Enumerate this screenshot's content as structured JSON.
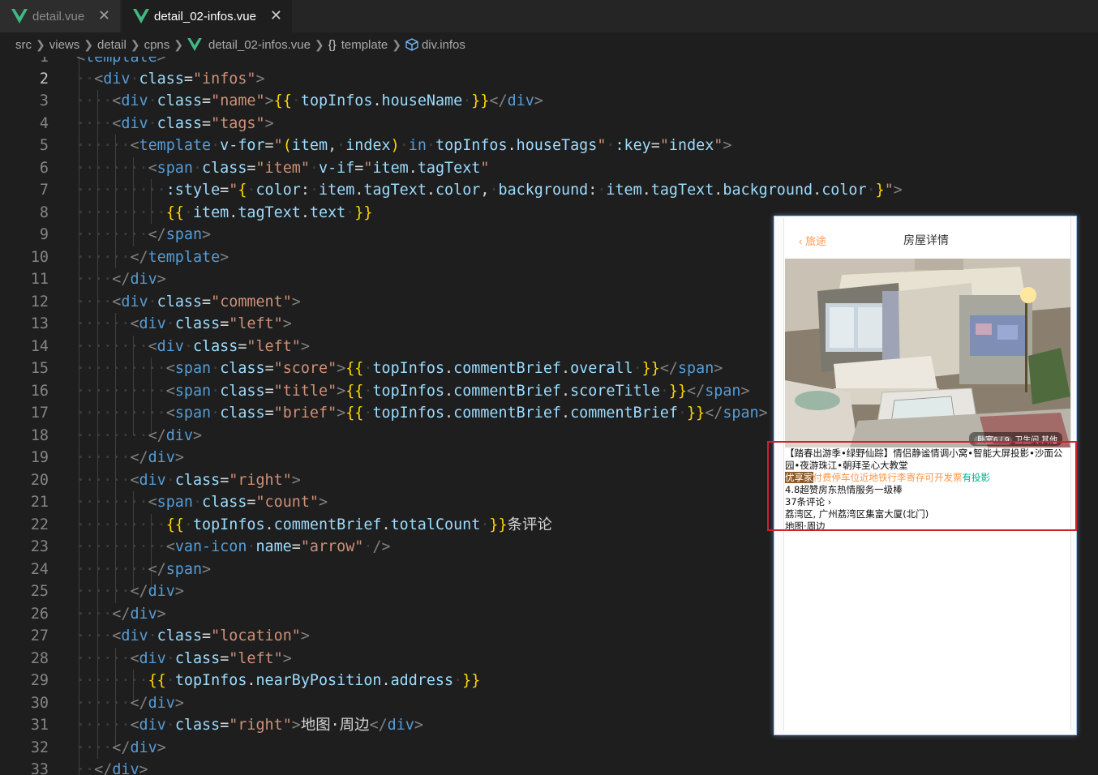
{
  "tabs": [
    {
      "label": "detail.vue"
    },
    {
      "label": "detail_02-infos.vue"
    }
  ],
  "breadcrumb": [
    "src",
    "views",
    "detail",
    "cpns",
    "detail_02-infos.vue",
    "template",
    "div.infos"
  ],
  "editor": {
    "current_line": 2
  },
  "preview": {
    "back_label": "旅途",
    "title": "房屋详情",
    "photo_indicator": {
      "active": "卧室6 / 9",
      "rest": "卫生间  其他"
    },
    "house_name": "【踏春出游季•绿野仙踪】情侣静谧情调小窝•智能大屏投影•沙面公园•夜游珠江•朝拜圣心大教堂",
    "tags": [
      {
        "text": "优享家",
        "color": "#ffffff",
        "background": "#8b5a2b"
      },
      {
        "text": "付费停车位近地铁行李寄存可开发票",
        "color": "#ff9645",
        "background": ""
      },
      {
        "text": "有投影",
        "color": "#00b38a",
        "background": ""
      }
    ],
    "comment_line": "4.8超赞房东热情服务一级棒",
    "count_line": "37条评论",
    "address": "荔湾区, 广州荔湾区集富大厦(北门)",
    "map_link": "地图·周边"
  }
}
